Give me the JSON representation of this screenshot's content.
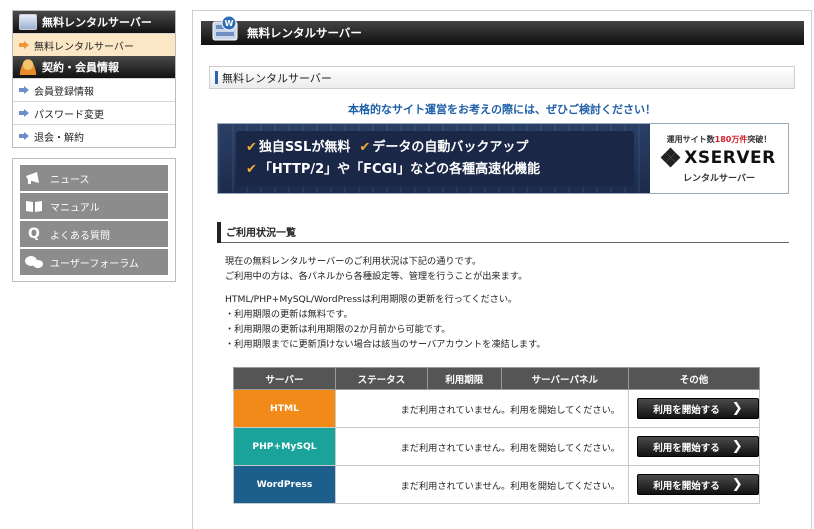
{
  "sidebar": {
    "server_section": {
      "title": "無料レンタルサーバー",
      "items": [
        {
          "label": "無料レンタルサーバー",
          "active": true
        }
      ]
    },
    "account_section": {
      "title": "契約・会員情報",
      "items": [
        {
          "label": "会員登録情報"
        },
        {
          "label": "パスワード変更"
        },
        {
          "label": "退会・解約"
        }
      ]
    },
    "links": [
      {
        "label": "ニュース",
        "icon": "megaphone-icon"
      },
      {
        "label": "マニュアル",
        "icon": "book-icon"
      },
      {
        "label": "よくある質問",
        "icon": "q-icon"
      },
      {
        "label": "ユーザーフォーラム",
        "icon": "chat-bubbles-icon"
      }
    ]
  },
  "main": {
    "header_title": "無料レンタルサーバー",
    "page_title": "無料レンタルサーバー",
    "tagline": "本格的なサイト運営をお考えの際には、ぜひご検討ください！",
    "banner": {
      "line1_a": "独自SSLが無料",
      "line1_b": "データの自動バックアップ",
      "line2": "「HTTP/2」や「FCGI」などの各種高速化機能",
      "stat_prefix": "運用サイト数",
      "stat_value": "180万件",
      "stat_suffix": "突破！",
      "brand": "XSERVER",
      "brand_sub": "レンタルサーバー"
    },
    "section_title": "ご利用状況一覧",
    "description": [
      "現在の無料レンタルサーバーのご利用状況は下記の通りです。",
      "ご利用中の方は、各パネルから各種設定等、管理を行うことが出来ます。",
      "HTML/PHP+MySQL/WordPressは利用期限の更新を行ってください。",
      "・利用期限の更新は無料です。",
      "・利用期限の更新は利用期限の2か月前から可能です。",
      "・利用期限までに更新頂けない場合は該当のサーバアカウントを凍結します。"
    ],
    "table": {
      "headers": [
        "サーバー",
        "ステータス",
        "利用期限",
        "サーバーパネル",
        "その他"
      ],
      "rows": [
        {
          "plan": "HTML",
          "status": "まだ利用されていません。利用を開始してください。",
          "button": "利用を開始する"
        },
        {
          "plan": "PHP+MySQL",
          "status": "まだ利用されていません。利用を開始してください。",
          "button": "利用を開始する"
        },
        {
          "plan": "WordPress",
          "status": "まだ利用されていません。利用を開始してください。",
          "button": "利用を開始する"
        }
      ]
    }
  },
  "colors": {
    "accent_blue": "#1f60a8",
    "html_plan": "#f28a1a",
    "php_plan": "#1aa39a",
    "wp_plan": "#1d5f8c",
    "active_nav_bg": "#fbe6c6"
  }
}
